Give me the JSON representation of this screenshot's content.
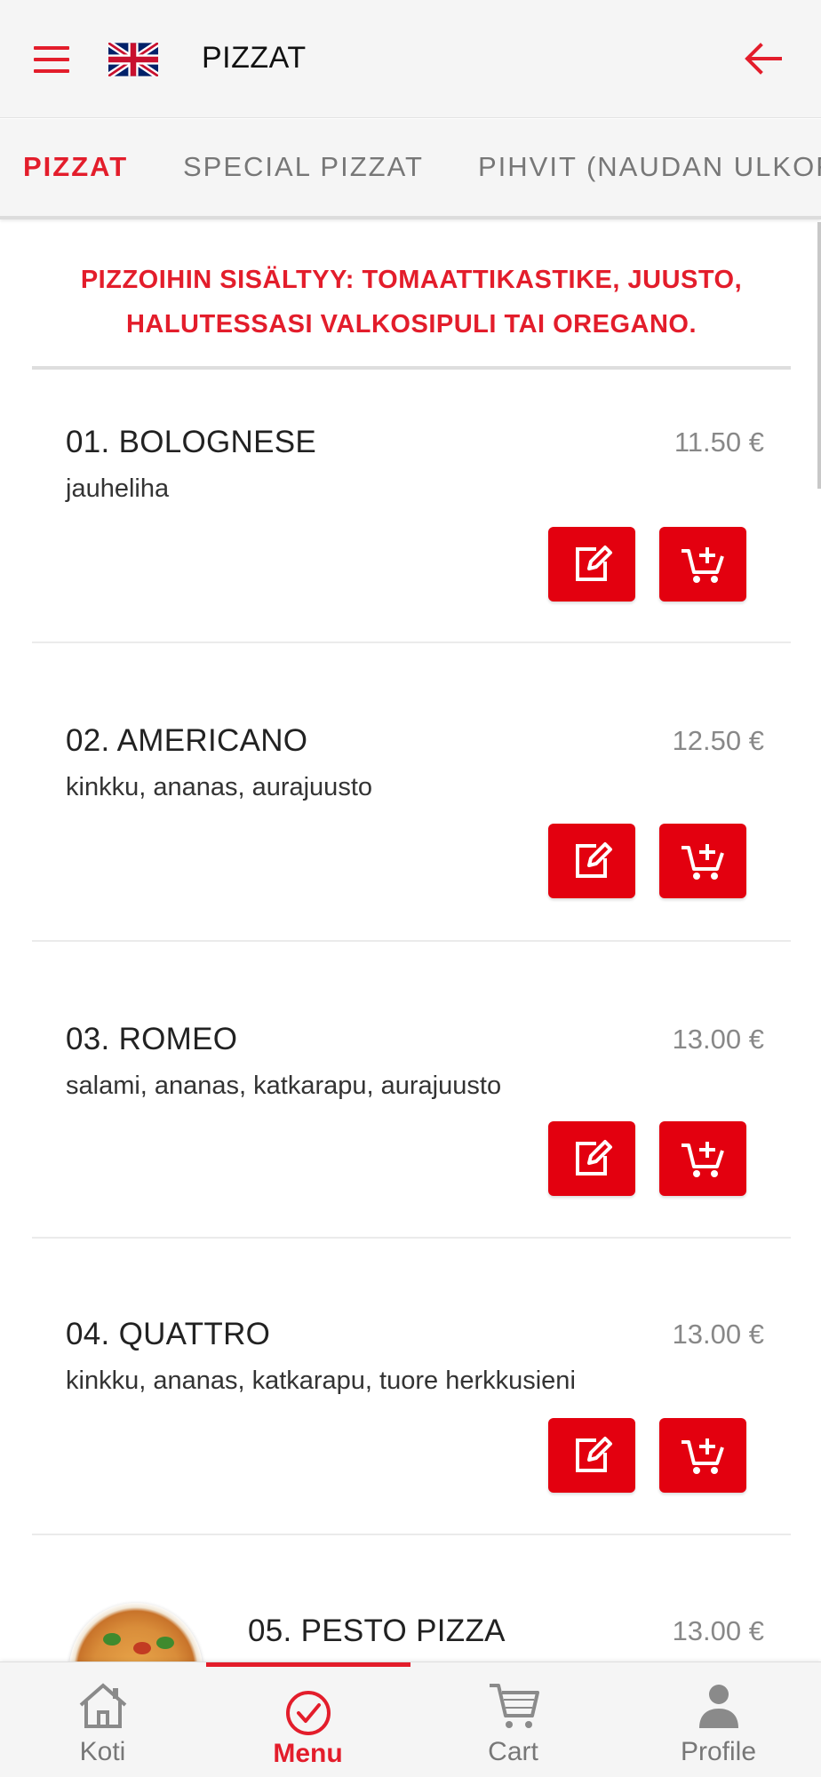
{
  "header": {
    "title": "PIZZAT",
    "menu_icon": "hamburger-icon",
    "language_icon": "uk-flag-icon",
    "back_icon": "arrow-left-icon"
  },
  "tabs": [
    {
      "label": "PIZZAT",
      "active": true
    },
    {
      "label": "SPECIAL PIZZAT",
      "active": false
    },
    {
      "label": "PIHVIT (NAUDAN ULKOFILE)",
      "active": false
    }
  ],
  "notice": "PIZZOIHIN SISÄLTYY: TOMAATTIKASTIKE, JUUSTO, HALUTESSASI VALKOSIPULI TAI OREGANO.",
  "items": [
    {
      "name": "01. BOLOGNESE",
      "price": "11.50 €",
      "description": "jauheliha"
    },
    {
      "name": "02. AMERICANO",
      "price": "12.50 €",
      "description": "kinkku, ananas, aurajuusto"
    },
    {
      "name": "03. ROMEO",
      "price": "13.00 €",
      "description": "salami, ananas, katkarapu, aurajuusto"
    },
    {
      "name": "04. QUATTRO",
      "price": "13.00 €",
      "description": "kinkku, ananas, katkarapu, tuore herkkusieni"
    },
    {
      "name": "05. PESTO PIZZA",
      "price": "13.00 €",
      "description": ""
    }
  ],
  "bottom_nav": [
    {
      "label": "Koti",
      "icon": "home-icon",
      "active": false
    },
    {
      "label": "Menu",
      "icon": "check-circle-icon",
      "active": true
    },
    {
      "label": "Cart",
      "icon": "cart-icon",
      "active": false
    },
    {
      "label": "Profile",
      "icon": "person-icon",
      "active": false
    }
  ],
  "colors": {
    "accent": "#e31d2b",
    "button": "#e3000f",
    "bar_background": "#f5f5f5"
  }
}
